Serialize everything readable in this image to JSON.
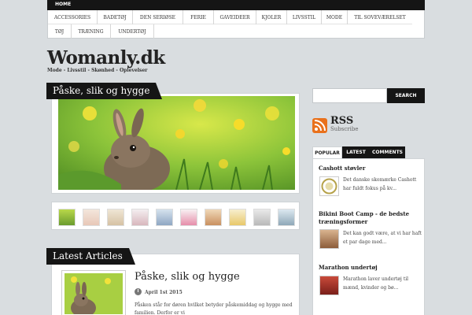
{
  "topnav": {
    "home": "Home"
  },
  "categories_row1": [
    "Accessories",
    "Badetøj",
    "Den seriøse",
    "Ferie",
    "Gaveideer",
    "Kjoler",
    "Livsstil",
    "Mode",
    "Til soveværelset"
  ],
  "categories_row2": [
    "Tøj",
    "Træning",
    "Undertøj"
  ],
  "site": {
    "title": "Womanly.dk",
    "tagline": "Mode - Livsstil - Skønhed - Oplevelser"
  },
  "featured": {
    "title": "Påske, slik og hygge"
  },
  "latest": {
    "heading": "Latest Articles",
    "article": {
      "title": "Påske, slik og hygge",
      "date": "April 1st 2015",
      "excerpt": "Påsken står for døren hvilket betyder påskemiddag og hygge med familien. Derfor er vi"
    }
  },
  "search": {
    "placeholder": "",
    "button": "Search"
  },
  "rss": {
    "title": "RSS",
    "subtitle": "Subscribe"
  },
  "tabs": [
    "Popular",
    "Latest",
    "Comments"
  ],
  "popular": [
    {
      "title": "Cashott støvler",
      "text": "Det danske skomærke Cashott har fuldt fokus på kv..."
    },
    {
      "title": "Bikini Boot Camp - de bedste træningsformer",
      "text": "Det kan godt være, at vi har haft et par dage med..."
    },
    {
      "title": "Marathon undertøj",
      "text": "Marathon laver undertøj til mænd, kvinder og bø..."
    }
  ],
  "colors": {
    "accent": "#151515",
    "background": "#d9dde0",
    "rss": "#e9711c"
  }
}
